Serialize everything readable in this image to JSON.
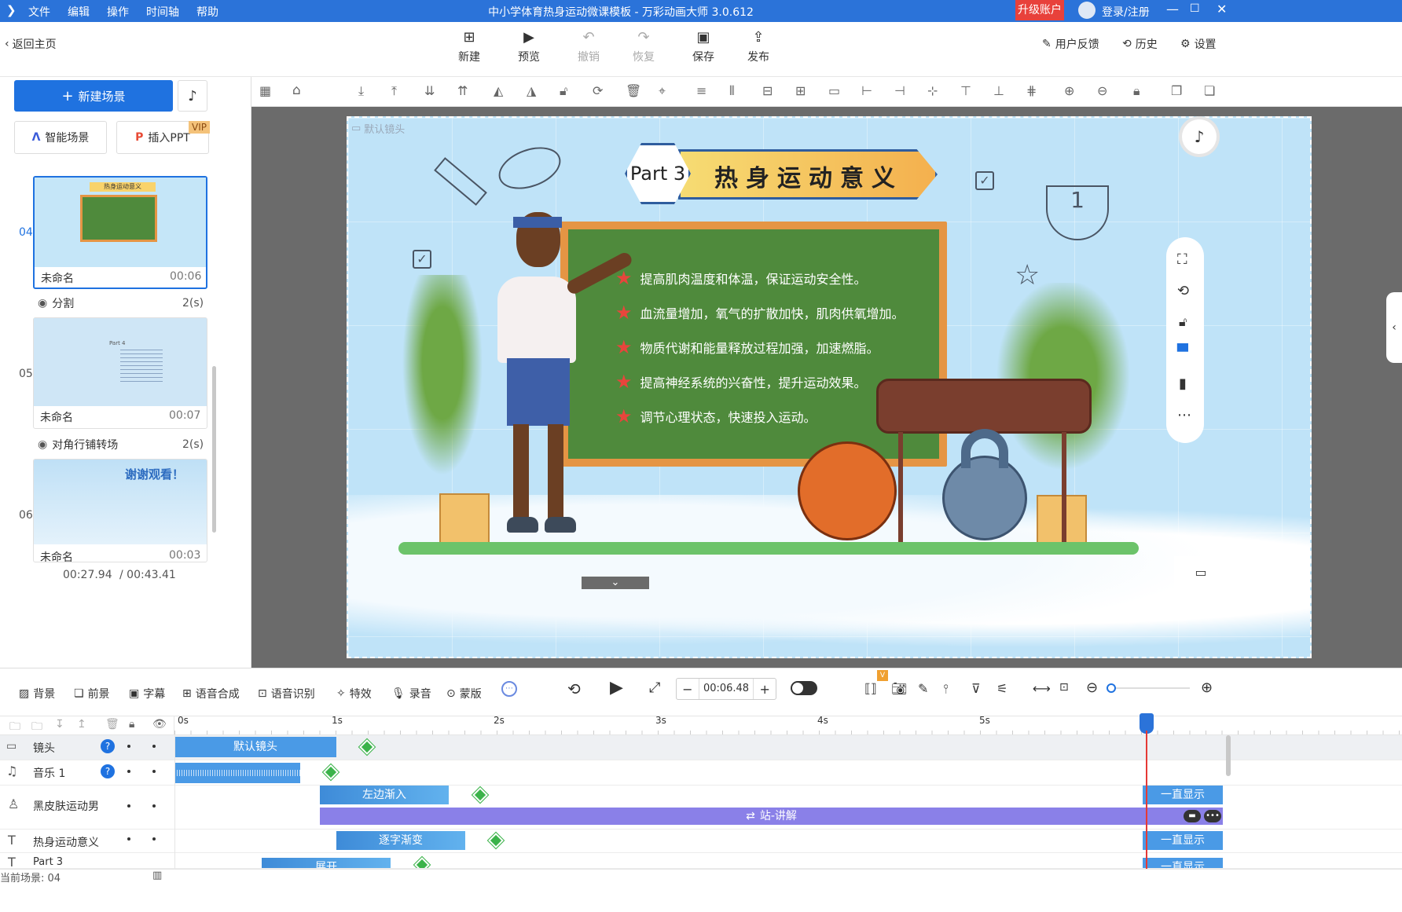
{
  "titlebar": {
    "menu": [
      "文件",
      "编辑",
      "操作",
      "时间轴",
      "帮助"
    ],
    "title": "中小学体育热身运动微课模板 - 万彩动画大师 3.0.612",
    "upgrade": "升级账户",
    "login": "登录/注册"
  },
  "toolbar": {
    "back": "返回主页",
    "buttons": [
      "新建",
      "预览",
      "撤销",
      "恢复",
      "保存",
      "发布"
    ],
    "right": [
      "用户反馈",
      "历史",
      "设置"
    ]
  },
  "left": {
    "new_scene": "新建场景",
    "smart_scene": "智能场景",
    "insert_ppt": "插入PPT",
    "vip": "VIP",
    "scenes": [
      {
        "num": "04",
        "name": "未命名",
        "time": "00:06"
      },
      {
        "num": "05",
        "name": "未命名",
        "time": "00:07"
      },
      {
        "num": "06",
        "name": "未命名",
        "time": "00:03"
      }
    ],
    "transitions": [
      {
        "name": "分割",
        "dur": "2(s)"
      },
      {
        "name": "对角行铺转场",
        "dur": "2(s)"
      }
    ],
    "thumb6_text": "谢谢观看！",
    "thumb4_title": "热身运动意义",
    "thumb5_title": "Part 4",
    "current_time": "00:27.94",
    "total_time": "/ 00:43.41"
  },
  "stage": {
    "camera_label": "默认镜头",
    "part": "Part 3",
    "heading": "热身运动意义",
    "bullets": [
      "提高肌肉温度和体温，保证运动安全性。",
      "血流量增加，氧气的扩散加快，肌肉供氧增加。",
      "物质代谢和能量释放过程加强，加速燃脂。",
      "提高神经系统的兴奋性，提升运动效果。",
      "调节心理状态，快速投入运动。"
    ]
  },
  "bottombar": {
    "items": [
      "背景",
      "前景",
      "字幕",
      "语音合成",
      "语音识别",
      "特效",
      "录音",
      "蒙版"
    ],
    "time": "00:06.48",
    "v_badge": "V"
  },
  "timeline": {
    "ticks": [
      "0s",
      "1s",
      "2s",
      "3s",
      "4s",
      "5s"
    ],
    "tracks": [
      {
        "name": "镜头",
        "clips": [
          "默认镜头"
        ]
      },
      {
        "name": "音乐 1",
        "clips": []
      },
      {
        "name": "黑皮肤运动男",
        "clips": [
          "左边渐入",
          "一直显示",
          "站-讲解"
        ]
      },
      {
        "name": "热身运动意义",
        "clips": [
          "逐字渐变",
          "一直显示"
        ]
      },
      {
        "name": "Part 3",
        "clips": [
          "展开",
          "一直显示"
        ]
      }
    ],
    "current_scene": "当前场景: 04"
  },
  "colors": {
    "accent": "#2b73d9",
    "green_board": "#4f8a3c",
    "clip_blue": "#4a9ae6",
    "purple": "#8a80e8"
  }
}
